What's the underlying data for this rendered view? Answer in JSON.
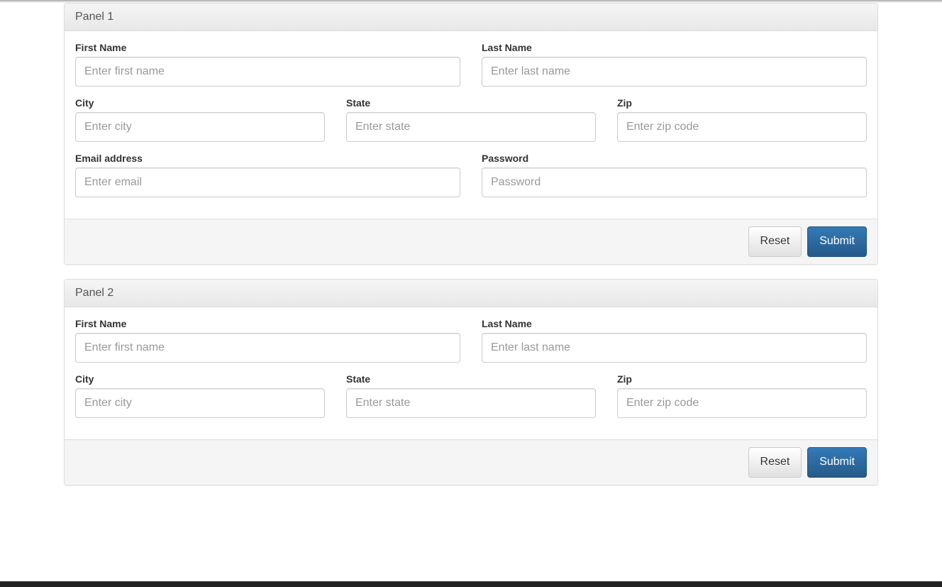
{
  "panel1": {
    "title": "Panel 1",
    "first_name": {
      "label": "First Name",
      "placeholder": "Enter first name"
    },
    "last_name": {
      "label": "Last Name",
      "placeholder": "Enter last name"
    },
    "city": {
      "label": "City",
      "placeholder": "Enter city"
    },
    "state": {
      "label": "State",
      "placeholder": "Enter state"
    },
    "zip": {
      "label": "Zip",
      "placeholder": "Enter zip code"
    },
    "email": {
      "label": "Email address",
      "placeholder": "Enter email"
    },
    "password": {
      "label": "Password",
      "placeholder": "Password"
    },
    "reset_label": "Reset",
    "submit_label": "Submit"
  },
  "panel2": {
    "title": "Panel 2",
    "first_name": {
      "label": "First Name",
      "placeholder": "Enter first name"
    },
    "last_name": {
      "label": "Last Name",
      "placeholder": "Enter last name"
    },
    "city": {
      "label": "City",
      "placeholder": "Enter city"
    },
    "state": {
      "label": "State",
      "placeholder": "Enter state"
    },
    "zip": {
      "label": "Zip",
      "placeholder": "Enter zip code"
    },
    "reset_label": "Reset",
    "submit_label": "Submit"
  }
}
